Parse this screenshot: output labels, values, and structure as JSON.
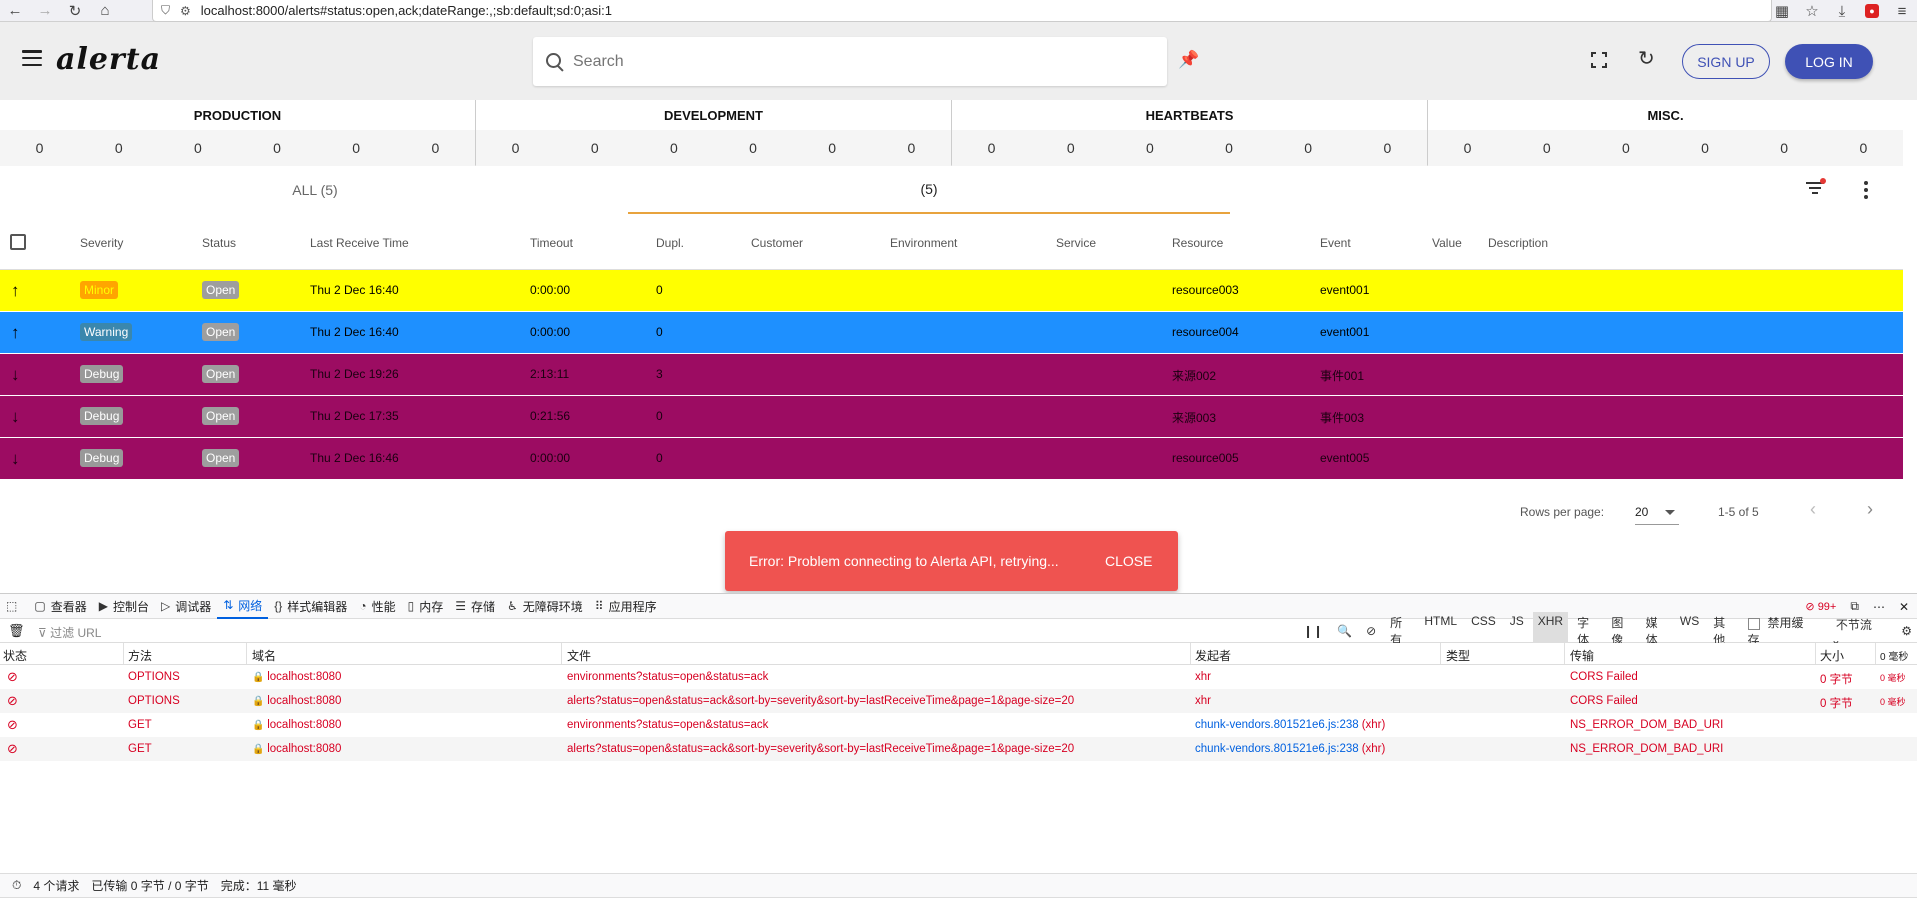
{
  "browser": {
    "url": "localhost:8000/alerts#status:open,ack;dateRange:,;sb:default;sd:0;asi:1"
  },
  "app": {
    "logo": "alerta",
    "search_placeholder": "Search",
    "signup_label": "SIGN UP",
    "login_label": "LOG IN",
    "accent": "#3f51b5"
  },
  "environments": [
    {
      "name": "PRODUCTION",
      "counts": [
        "0",
        "0",
        "0",
        "0",
        "0",
        "0"
      ]
    },
    {
      "name": "DEVELOPMENT",
      "counts": [
        "0",
        "0",
        "0",
        "0",
        "0",
        "0"
      ]
    },
    {
      "name": "HEARTBEATS",
      "counts": [
        "0",
        "0",
        "0",
        "0",
        "0",
        "0"
      ]
    },
    {
      "name": "MISC.",
      "counts": [
        "0",
        "0",
        "0",
        "0",
        "0",
        "0"
      ]
    }
  ],
  "tabs": [
    {
      "label": "ALL (5)"
    },
    {
      "label": "(5)"
    }
  ],
  "table": {
    "headers": {
      "severity": "Severity",
      "status": "Status",
      "last_receive_time": "Last Receive Time",
      "timeout": "Timeout",
      "dupl": "Dupl.",
      "customer": "Customer",
      "environment": "Environment",
      "service": "Service",
      "resource": "Resource",
      "event": "Event",
      "value": "Value",
      "description": "Description"
    },
    "rows": [
      {
        "arrow": "↑",
        "severity": "Minor",
        "status": "Open",
        "time": "Thu 2 Dec 16:40",
        "timeout": "0:00:00",
        "dupl": "0",
        "resource": "resource003",
        "event": "event001",
        "bg": "#ffff00",
        "fg": "#000000",
        "sev_bg": "#ffa500",
        "sev_fg": "#ffff00"
      },
      {
        "arrow": "↑",
        "severity": "Warning",
        "status": "Open",
        "time": "Thu 2 Dec 16:40",
        "timeout": "0:00:00",
        "dupl": "0",
        "resource": "resource004",
        "event": "event001",
        "bg": "#1e90ff",
        "fg": "#000000",
        "sev_bg": "#3a87ad",
        "sev_fg": "#ffffff"
      },
      {
        "arrow": "↓",
        "severity": "Debug",
        "status": "Open",
        "time": "Thu 2 Dec 19:26",
        "timeout": "2:13:11",
        "dupl": "3",
        "resource": "来源002",
        "event": "事件001",
        "bg": "#9c0c62",
        "fg": "#1a0010",
        "sev_bg": "#999999",
        "sev_fg": "#ffffff"
      },
      {
        "arrow": "↓",
        "severity": "Debug",
        "status": "Open",
        "time": "Thu 2 Dec 17:35",
        "timeout": "0:21:56",
        "dupl": "0",
        "resource": "来源003",
        "event": "事件003",
        "bg": "#9c0c62",
        "fg": "#1a0010",
        "sev_bg": "#999999",
        "sev_fg": "#ffffff"
      },
      {
        "arrow": "↓",
        "severity": "Debug",
        "status": "Open",
        "time": "Thu 2 Dec 16:46",
        "timeout": "0:00:00",
        "dupl": "0",
        "resource": "resource005",
        "event": "event005",
        "bg": "#9c0c62",
        "fg": "#1a0010",
        "sev_bg": "#999999",
        "sev_fg": "#ffffff"
      }
    ]
  },
  "pager": {
    "rows_per_page_label": "Rows per page:",
    "rows_per_page": "20",
    "range": "1-5 of 5"
  },
  "snackbar": {
    "message": "Error: Problem connecting to Alerta API, retrying...",
    "close": "CLOSE"
  },
  "devtools": {
    "tabs": [
      {
        "icon": "▢",
        "label": "查看器",
        "name": "inspector"
      },
      {
        "icon": "▶",
        "label": "控制台",
        "name": "console"
      },
      {
        "icon": "▷",
        "label": "调试器",
        "name": "debugger"
      },
      {
        "icon": "⇅",
        "label": "网络",
        "name": "network"
      },
      {
        "icon": "{}",
        "label": "样式编辑器",
        "name": "style-editor"
      },
      {
        "icon": "◔",
        "label": "性能",
        "name": "performance"
      },
      {
        "icon": "▯",
        "label": "内存",
        "name": "memory"
      },
      {
        "icon": "☰",
        "label": "存储",
        "name": "storage"
      },
      {
        "icon": "♿",
        "label": "无障碍环境",
        "name": "accessibility"
      },
      {
        "icon": "⠿",
        "label": "应用程序",
        "name": "application"
      }
    ],
    "error_count": "99+",
    "filter_placeholder": "过滤 URL",
    "type_filters": [
      "所有",
      "HTML",
      "CSS",
      "JS",
      "XHR",
      "字体",
      "图像",
      "媒体",
      "WS",
      "其他"
    ],
    "active_filter": "XHR",
    "disable_cache": "禁用缓存",
    "throttle": "不节流",
    "columns": {
      "status": "状态",
      "method": "方法",
      "domain": "域名",
      "file": "文件",
      "initiator": "发起者",
      "type": "类型",
      "transfer": "传输",
      "size": "大小",
      "time": "0 毫秒"
    },
    "requests": [
      {
        "method": "OPTIONS",
        "domain": "localhost:8080",
        "file": "environments?status=open&status=ack",
        "initiator": "xhr",
        "initiator_extra": "",
        "transfer": "CORS Failed",
        "size": "0 字节",
        "time": "0 毫秒"
      },
      {
        "method": "OPTIONS",
        "domain": "localhost:8080",
        "file": "alerts?status=open&status=ack&sort-by=severity&sort-by=lastReceiveTime&page=1&page-size=20",
        "initiator": "xhr",
        "initiator_extra": "",
        "transfer": "CORS Failed",
        "size": "0 字节",
        "time": "0 毫秒"
      },
      {
        "method": "GET",
        "domain": "localhost:8080",
        "file": "environments?status=open&status=ack",
        "initiator": "chunk-vendors.801521e6.js:238",
        "initiator_extra": "(xhr)",
        "transfer": "NS_ERROR_DOM_BAD_URI",
        "size": "",
        "time": ""
      },
      {
        "method": "GET",
        "domain": "localhost:8080",
        "file": "alerts?status=open&status=ack&sort-by=severity&sort-by=lastReceiveTime&page=1&page-size=20",
        "initiator": "chunk-vendors.801521e6.js:238",
        "initiator_extra": "(xhr)",
        "transfer": "NS_ERROR_DOM_BAD_URI",
        "size": "",
        "time": ""
      }
    ],
    "status_bar": {
      "requests": "4 个请求",
      "transferred": "已传输 0 字节 / 0 字节",
      "finished": "完成：11 毫秒"
    }
  }
}
